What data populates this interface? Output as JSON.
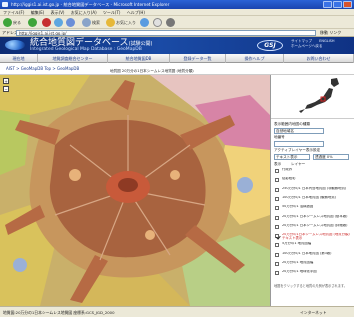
{
  "window": {
    "title": "http://iggis1.ai.ist.go.jp - 統合地質図データベース - Microsoft Internet Explorer"
  },
  "menu": [
    "ファイル(F)",
    "編集(E)",
    "表示(V)",
    "お気に入り(A)",
    "ツール(T)",
    "ヘルプ(H)"
  ],
  "toolbar": {
    "back_label": "戻る",
    "search_label": "検索",
    "favorites_label": "お気に入り"
  },
  "address": {
    "label": "アドレス(D)",
    "url": "http://iggis1.ai.ist.go.jp/",
    "go_label": "移動  リンク"
  },
  "banner": {
    "title": "統合地質図データベース",
    "title_suffix": "(試験公開)",
    "subtitle": "Integrated Geological Map Database : GeoMapDB",
    "logo_text": "GSJ",
    "sitemap_link": "サイトマップ",
    "lang_link": "ENGLISH",
    "help_link": "ホームページへ戻る"
  },
  "nav": [
    "現在地",
    "地質調査総合センター",
    "統合地質図DB",
    "登録データ一覧",
    "操作ヘルプ",
    "お問い合わせ"
  ],
  "breadcrumb": "AIST > GeoMapDB Top > GeoMapDB",
  "mapbar": {
    "zoom_text": "地質図 20万分の1日本シームレス地質図 (地質分類)"
  },
  "panel": {
    "display_range_label": "表示範囲内地図の種類",
    "map_select_value": "自然地域名",
    "map_number_label": "地番号",
    "active_layer_label": "アクティブレイヤー表示設定",
    "active_layer_value": "テキスト表示",
    "opacity_value": "透過度 0%",
    "display_label": "表示",
    "layers_heading": "レイヤー",
    "layers": [
      {
        "label": "行政界",
        "checked": false,
        "highlight": false
      },
      {
        "label": "陰影段彩",
        "checked": false,
        "highlight": false
      },
      {
        "label": "250万分の1 日本列島地質図 (非観察地質)",
        "checked": false,
        "highlight": false
      },
      {
        "label": "100万分の1 日本地質図 (観察地質)",
        "checked": false,
        "highlight": false
      },
      {
        "label": "50万分の1 活構造図",
        "checked": false,
        "highlight": false
      },
      {
        "label": "20万分の1 日本シームレス地質図 (基本版)",
        "checked": false,
        "highlight": false
      },
      {
        "label": "20万分の1 日本シームレス地質図 (詳細版)",
        "checked": false,
        "highlight": false
      },
      {
        "label": "20万分の1日本シームレス地質図 (地質分類) テキスト表示",
        "checked": true,
        "highlight": true
      },
      {
        "label": "5万分の1 地質図幅",
        "checked": false,
        "highlight": false
      },
      {
        "label": "100万分の1 日本地質図 (第3版)",
        "checked": false,
        "highlight": false
      },
      {
        "label": "20万分の1 地質図幅",
        "checked": false,
        "highlight": false
      },
      {
        "label": "20万分の1 地球化学図",
        "checked": false,
        "highlight": false
      }
    ],
    "note": "地図をクリックすると地質の凡例が表示されます。"
  },
  "status": {
    "left": "地質図:20万分の1日本シームレス地質図 座標系:GCS_JGD_2000",
    "right": "インターネット"
  },
  "colors": {
    "titlebar": "#1a45b0",
    "banner": "#0d2c74",
    "highlight": "#c81e1e"
  }
}
